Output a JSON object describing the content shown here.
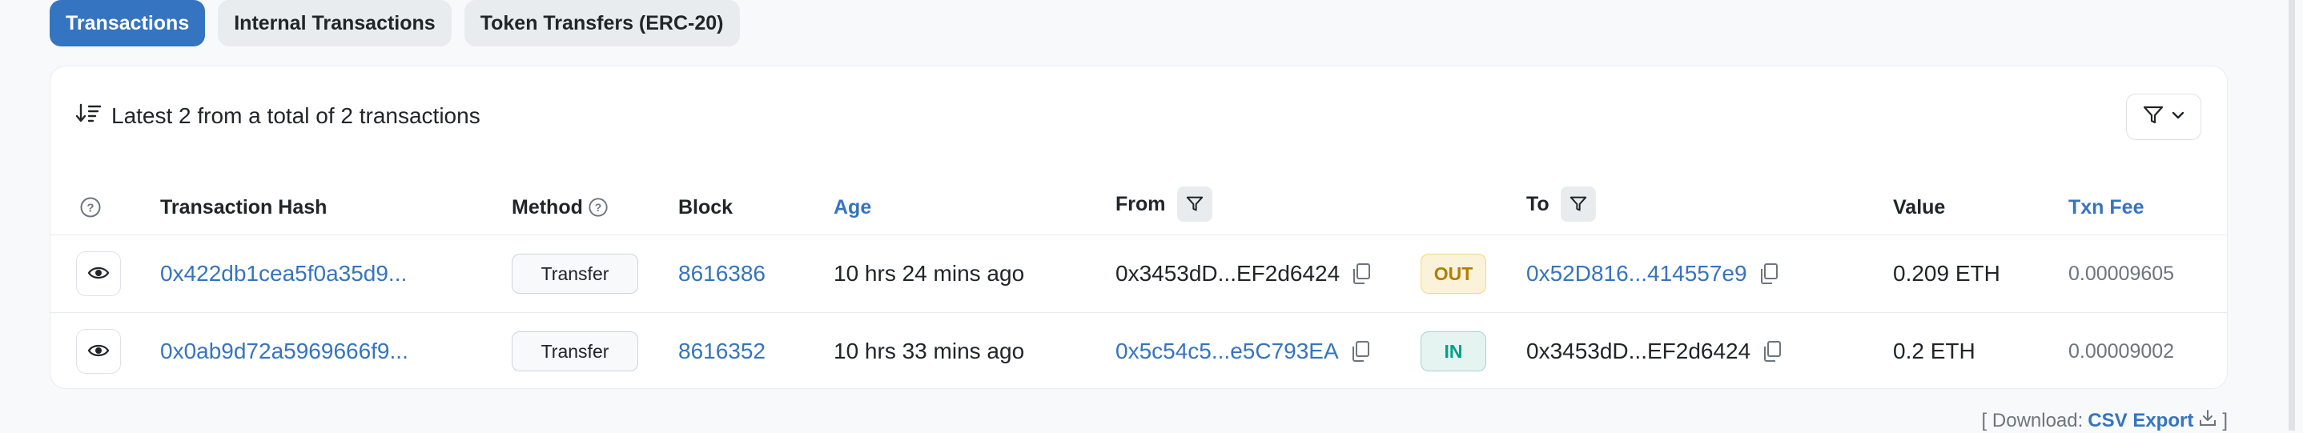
{
  "tabs": [
    {
      "label": "Transactions",
      "active": true
    },
    {
      "label": "Internal Transactions",
      "active": false
    },
    {
      "label": "Token Transfers (ERC-20)",
      "active": false
    }
  ],
  "summary": "Latest 2 from a total of 2 transactions",
  "columns": {
    "hash": "Transaction Hash",
    "method": "Method",
    "block": "Block",
    "age": "Age",
    "from": "From",
    "to": "To",
    "value": "Value",
    "fee": "Txn Fee"
  },
  "rows": [
    {
      "hash": "0x422db1cea5f0a35d9...",
      "method": "Transfer",
      "block": "8616386",
      "age": "10 hrs 24 mins ago",
      "from": "0x3453dD...EF2d6424",
      "direction": "OUT",
      "to": "0x52D816...414557e9",
      "value": "0.209 ETH",
      "fee": "0.00009605"
    },
    {
      "hash": "0x0ab9d72a5969666f9...",
      "method": "Transfer",
      "block": "8616352",
      "age": "10 hrs 33 mins ago",
      "from": "0x5c54c5...e5C793EA",
      "direction": "IN",
      "to": "0x3453dD...EF2d6424",
      "value": "0.2 ETH",
      "fee": "0.00009002"
    }
  ],
  "download": {
    "prefix": "[ Download:",
    "link": "CSV Export",
    "suffix": "]"
  },
  "colors": {
    "accent": "#3574c0",
    "out_badge": "#b47d00",
    "in_badge": "#00a186"
  }
}
